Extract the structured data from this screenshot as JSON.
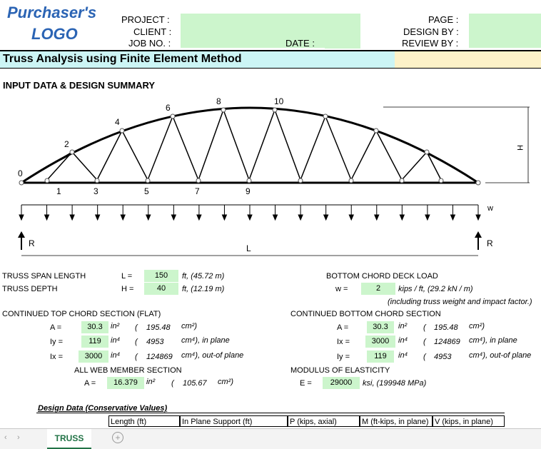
{
  "logo": {
    "line1": "Purchaser's",
    "line2": "LOGO"
  },
  "header": {
    "project_label": "PROJECT :",
    "client_label": "CLIENT :",
    "job_label": "JOB NO. :",
    "date_label": "DATE :",
    "page_label": "PAGE :",
    "design_by_label": "DESIGN BY :",
    "review_by_label": "REVIEW BY :"
  },
  "title": "Truss Analysis using Finite Element Method",
  "section_heading": "INPUT DATA & DESIGN SUMMARY",
  "diagram": {
    "top_nodes": [
      "0",
      "2",
      "4",
      "6",
      "8",
      "10"
    ],
    "bottom_nodes": [
      "1",
      "3",
      "5",
      "7",
      "9"
    ],
    "h_label": "H",
    "w_label": "w",
    "l_label": "L",
    "r_left": "R",
    "r_right": "R"
  },
  "inputs": {
    "span": {
      "label": "TRUSS SPAN LENGTH",
      "sym": "L =",
      "value": "150",
      "unit": "ft, (45.72 m)"
    },
    "depth": {
      "label": "TRUSS DEPTH",
      "sym": "H =",
      "value": "40",
      "unit": "ft, (12.19 m)"
    },
    "deck_load": {
      "label": "BOTTOM CHORD DECK LOAD",
      "sym": "w =",
      "value": "2",
      "unit": "kips / ft, (29.2 kN / m)",
      "note": "(including truss weight and impact factor.)"
    }
  },
  "top_chord": {
    "heading": "CONTINUED TOP CHORD SECTION (FLAT)",
    "rows": [
      {
        "sym": "A =",
        "value": "30.3",
        "unit": "in²",
        "paren": "(",
        "metric": "195.48",
        "metric_unit": "cm²)",
        "note": ""
      },
      {
        "sym": "Iy =",
        "value": "119",
        "unit": "in⁴",
        "paren": "(",
        "metric": "4953",
        "metric_unit": "cm⁴), in plane",
        "note": ""
      },
      {
        "sym": "Ix =",
        "value": "3000",
        "unit": "in⁴",
        "paren": "(",
        "metric": "124869",
        "metric_unit": "cm⁴), out-of plane",
        "note": ""
      }
    ]
  },
  "bottom_chord": {
    "heading": "CONTINUED BOTTOM CHORD SECTION",
    "rows": [
      {
        "sym": "A =",
        "value": "30.3",
        "unit": "in²",
        "paren": "(",
        "metric": "195.48",
        "metric_unit": "cm²)"
      },
      {
        "sym": "Ix =",
        "value": "3000",
        "unit": "in⁴",
        "paren": "(",
        "metric": "124869",
        "metric_unit": "cm⁴), in plane"
      },
      {
        "sym": "Iy =",
        "value": "119",
        "unit": "in⁴",
        "paren": "(",
        "metric": "4953",
        "metric_unit": "cm⁴), out-of plane"
      }
    ]
  },
  "web": {
    "heading": "ALL WEB MEMBER SECTION",
    "sym": "A =",
    "value": "16.379",
    "unit": "in²",
    "paren": "(",
    "metric": "105.67",
    "metric_unit": "cm²)"
  },
  "modulus": {
    "heading": "MODULUS OF ELASTICITY",
    "sym": "E =",
    "value": "29000",
    "unit": "ksi, (199948 MPa)"
  },
  "design_table": {
    "title": "Design Data (Conservative Values)",
    "columns": [
      "Length (ft)",
      "In Plane Support (ft)",
      "P (kips, axial)",
      "M (ft-kips, in plane)",
      "V (kips, in plane)"
    ]
  },
  "sheet": {
    "tab": "TRUSS",
    "add_icon": "plus-circle-icon"
  },
  "colors": {
    "green": "#ccf5cc",
    "title_bg": "#ccf5f5",
    "title_right": "#fdf2c8",
    "logo": "#2b64b4"
  }
}
